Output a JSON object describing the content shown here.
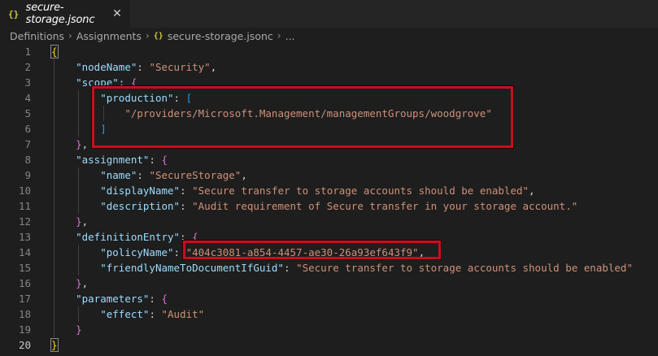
{
  "tab": {
    "icon": "{}",
    "title": "secure-storage.jsonc",
    "close": "✕"
  },
  "breadcrumb": [
    "Definitions",
    "Assignments",
    "secure-storage.jsonc",
    "..."
  ],
  "breadcrumb_icon": "{}",
  "breadcrumb_sep": "›",
  "lines": [
    {
      "n": "1",
      "tokens": [
        {
          "c": "b1",
          "t": "{"
        }
      ]
    },
    {
      "n": "2",
      "tokens": [
        {
          "c": "p",
          "t": "    "
        },
        {
          "c": "k",
          "t": "\"nodeName\""
        },
        {
          "c": "p",
          "t": ": "
        },
        {
          "c": "s",
          "t": "\"Security\""
        },
        {
          "c": "p",
          "t": ","
        }
      ]
    },
    {
      "n": "3",
      "tokens": [
        {
          "c": "p",
          "t": "    "
        },
        {
          "c": "k",
          "t": "\"scope\""
        },
        {
          "c": "p",
          "t": ": "
        },
        {
          "c": "b2",
          "t": "{"
        }
      ]
    },
    {
      "n": "4",
      "tokens": [
        {
          "c": "p",
          "t": "        "
        },
        {
          "c": "k",
          "t": "\"production\""
        },
        {
          "c": "p",
          "t": ": "
        },
        {
          "c": "b3",
          "t": "["
        }
      ]
    },
    {
      "n": "5",
      "tokens": [
        {
          "c": "p",
          "t": "            "
        },
        {
          "c": "s",
          "t": "\"/providers/Microsoft.Management/managementGroups/woodgrove\""
        }
      ]
    },
    {
      "n": "6",
      "tokens": [
        {
          "c": "p",
          "t": "        "
        },
        {
          "c": "b3",
          "t": "]"
        }
      ]
    },
    {
      "n": "7",
      "tokens": [
        {
          "c": "p",
          "t": "    "
        },
        {
          "c": "b2",
          "t": "}"
        },
        {
          "c": "p",
          "t": ","
        }
      ]
    },
    {
      "n": "8",
      "tokens": [
        {
          "c": "p",
          "t": "    "
        },
        {
          "c": "k",
          "t": "\"assignment\""
        },
        {
          "c": "p",
          "t": ": "
        },
        {
          "c": "b2",
          "t": "{"
        }
      ]
    },
    {
      "n": "9",
      "tokens": [
        {
          "c": "p",
          "t": "        "
        },
        {
          "c": "k",
          "t": "\"name\""
        },
        {
          "c": "p",
          "t": ": "
        },
        {
          "c": "s",
          "t": "\"SecureStorage\""
        },
        {
          "c": "p",
          "t": ","
        }
      ]
    },
    {
      "n": "10",
      "tokens": [
        {
          "c": "p",
          "t": "        "
        },
        {
          "c": "k",
          "t": "\"displayName\""
        },
        {
          "c": "p",
          "t": ": "
        },
        {
          "c": "s",
          "t": "\"Secure transfer to storage accounts should be enabled\""
        },
        {
          "c": "p",
          "t": ","
        }
      ]
    },
    {
      "n": "11",
      "tokens": [
        {
          "c": "p",
          "t": "        "
        },
        {
          "c": "k",
          "t": "\"description\""
        },
        {
          "c": "p",
          "t": ": "
        },
        {
          "c": "s",
          "t": "\"Audit requirement of Secure transfer in your storage account.\""
        }
      ]
    },
    {
      "n": "12",
      "tokens": [
        {
          "c": "p",
          "t": "    "
        },
        {
          "c": "b2",
          "t": "}"
        },
        {
          "c": "p",
          "t": ","
        }
      ]
    },
    {
      "n": "13",
      "tokens": [
        {
          "c": "p",
          "t": "    "
        },
        {
          "c": "k",
          "t": "\"definitionEntry\""
        },
        {
          "c": "p",
          "t": ": "
        },
        {
          "c": "b2",
          "t": "{"
        }
      ]
    },
    {
      "n": "14",
      "tokens": [
        {
          "c": "p",
          "t": "        "
        },
        {
          "c": "k",
          "t": "\"policyName\""
        },
        {
          "c": "p",
          "t": ": "
        },
        {
          "c": "s",
          "t": "\"404c3081-a854-4457-ae30-26a93ef643f9\""
        },
        {
          "c": "p",
          "t": ","
        }
      ]
    },
    {
      "n": "15",
      "tokens": [
        {
          "c": "p",
          "t": "        "
        },
        {
          "c": "k",
          "t": "\"friendlyNameToDocumentIfGuid\""
        },
        {
          "c": "p",
          "t": ": "
        },
        {
          "c": "s",
          "t": "\"Secure transfer to storage accounts should be enabled\""
        }
      ]
    },
    {
      "n": "16",
      "tokens": [
        {
          "c": "p",
          "t": "    "
        },
        {
          "c": "b2",
          "t": "}"
        },
        {
          "c": "p",
          "t": ","
        }
      ]
    },
    {
      "n": "17",
      "tokens": [
        {
          "c": "p",
          "t": "    "
        },
        {
          "c": "k",
          "t": "\"parameters\""
        },
        {
          "c": "p",
          "t": ": "
        },
        {
          "c": "b2",
          "t": "{"
        }
      ]
    },
    {
      "n": "18",
      "tokens": [
        {
          "c": "p",
          "t": "        "
        },
        {
          "c": "k",
          "t": "\"effect\""
        },
        {
          "c": "p",
          "t": ": "
        },
        {
          "c": "s",
          "t": "\"Audit\""
        }
      ]
    },
    {
      "n": "19",
      "tokens": [
        {
          "c": "p",
          "t": "    "
        },
        {
          "c": "b2",
          "t": "}"
        }
      ]
    },
    {
      "n": "20",
      "tokens": [
        {
          "c": "b1",
          "t": "}"
        }
      ]
    }
  ],
  "active_line": "20",
  "colors": {
    "highlight_box": "#c50f1f",
    "key": "#9cdcfe",
    "string": "#ce9178",
    "bracket_level1": "#ffd700",
    "bracket_level2": "#da70d6",
    "bracket_level3": "#179fff"
  }
}
